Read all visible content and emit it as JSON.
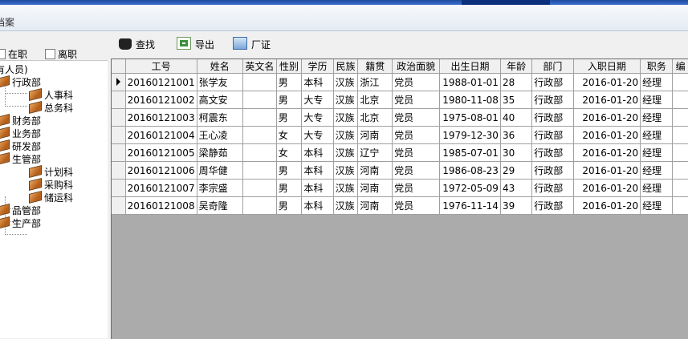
{
  "window": {
    "title": "档案"
  },
  "filter": {
    "on_job_label": "在职",
    "left_job_label": "离职"
  },
  "tree": {
    "root": "有人员)",
    "nodes": [
      {
        "label": "行政部"
      },
      {
        "label": "人事科"
      },
      {
        "label": "总务科"
      },
      {
        "label": "财务部"
      },
      {
        "label": "业务部"
      },
      {
        "label": "研发部"
      },
      {
        "label": "生管部"
      },
      {
        "label": "计划科"
      },
      {
        "label": "采购科"
      },
      {
        "label": "储运科"
      },
      {
        "label": "品管部"
      },
      {
        "label": "生产部"
      }
    ]
  },
  "toolbar": {
    "find_label": "查找",
    "export_label": "导出",
    "cert_label": "厂证"
  },
  "grid": {
    "columns": [
      "工号",
      "姓名",
      "英文名",
      "性别",
      "学历",
      "民族",
      "籍贯",
      "政治面貌",
      "出生日期",
      "年龄",
      "部门",
      "入职日期",
      "职务",
      "编"
    ],
    "rows": [
      [
        "20160121001",
        "张学友",
        "",
        "男",
        "本科",
        "汉族",
        "浙江",
        "党员",
        "1988-01-01",
        "28",
        "行政部",
        "2016-01-20",
        "经理"
      ],
      [
        "20160121002",
        "高文安",
        "",
        "男",
        "大专",
        "汉族",
        "北京",
        "党员",
        "1980-11-08",
        "35",
        "行政部",
        "2016-01-20",
        "经理"
      ],
      [
        "20160121003",
        "柯震东",
        "",
        "男",
        "大专",
        "汉族",
        "北京",
        "党员",
        "1975-08-01",
        "40",
        "行政部",
        "2016-01-20",
        "经理"
      ],
      [
        "20160121004",
        "王心凌",
        "",
        "女",
        "大专",
        "汉族",
        "河南",
        "党员",
        "1979-12-30",
        "36",
        "行政部",
        "2016-01-20",
        "经理"
      ],
      [
        "20160121005",
        "梁静茹",
        "",
        "女",
        "本科",
        "汉族",
        "辽宁",
        "党员",
        "1985-07-01",
        "30",
        "行政部",
        "2016-01-20",
        "经理"
      ],
      [
        "20160121006",
        "周华健",
        "",
        "男",
        "本科",
        "汉族",
        "河南",
        "党员",
        "1986-08-23",
        "29",
        "行政部",
        "2016-01-20",
        "经理"
      ],
      [
        "20160121007",
        "李宗盛",
        "",
        "男",
        "本科",
        "汉族",
        "河南",
        "党员",
        "1972-05-09",
        "43",
        "行政部",
        "2016-01-20",
        "经理"
      ],
      [
        "20160121008",
        "吴奇隆",
        "",
        "男",
        "本科",
        "汉族",
        "河南",
        "党员",
        "1976-11-14",
        "39",
        "行政部",
        "2016-01-20",
        "经理"
      ]
    ],
    "selected_row": 0
  },
  "icons": {
    "find": "binoculars-icon",
    "export": "excel-export-icon",
    "cert": "certificate-icon",
    "tree_node": "book-icon"
  }
}
